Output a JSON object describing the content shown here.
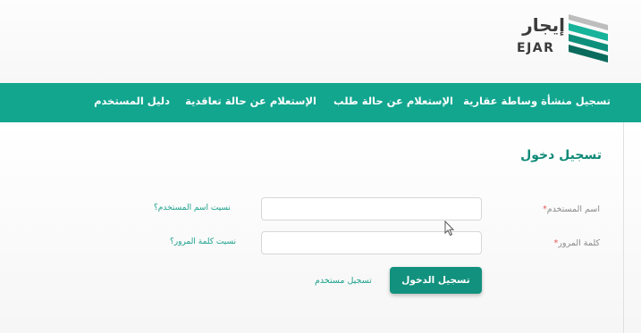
{
  "brand": {
    "name_ar": "إيجار",
    "name_en": "EJAR",
    "colors": {
      "primary": "#12a68f",
      "title": "#0f8a78",
      "button": "#12917e",
      "link": "#1aa08b"
    }
  },
  "nav": {
    "items": [
      {
        "label": "تسجيل منشأة وساطة عقارية"
      },
      {
        "label": "الإستعلام عن حالة طلب"
      },
      {
        "label": "الإستعلام عن حالة تعاقدية"
      },
      {
        "label": "دليل المستخدم"
      }
    ]
  },
  "login": {
    "title": "تسجيل دخول",
    "username": {
      "label": "اسم المستخدم",
      "required_mark": "*",
      "value": "",
      "placeholder": "",
      "forgot": "نسيت اسم المستخدم؟"
    },
    "password": {
      "label": "كلمة المرور",
      "required_mark": "*",
      "value": "",
      "placeholder": "",
      "forgot": "نسيت كلمة المرور؟"
    },
    "submit_label": "تسجيل الدخول",
    "register_label": "تسجيل مستخدم"
  },
  "icons": {
    "logo": "ejar-logo-icon",
    "cursor": "mouse-cursor-icon"
  }
}
